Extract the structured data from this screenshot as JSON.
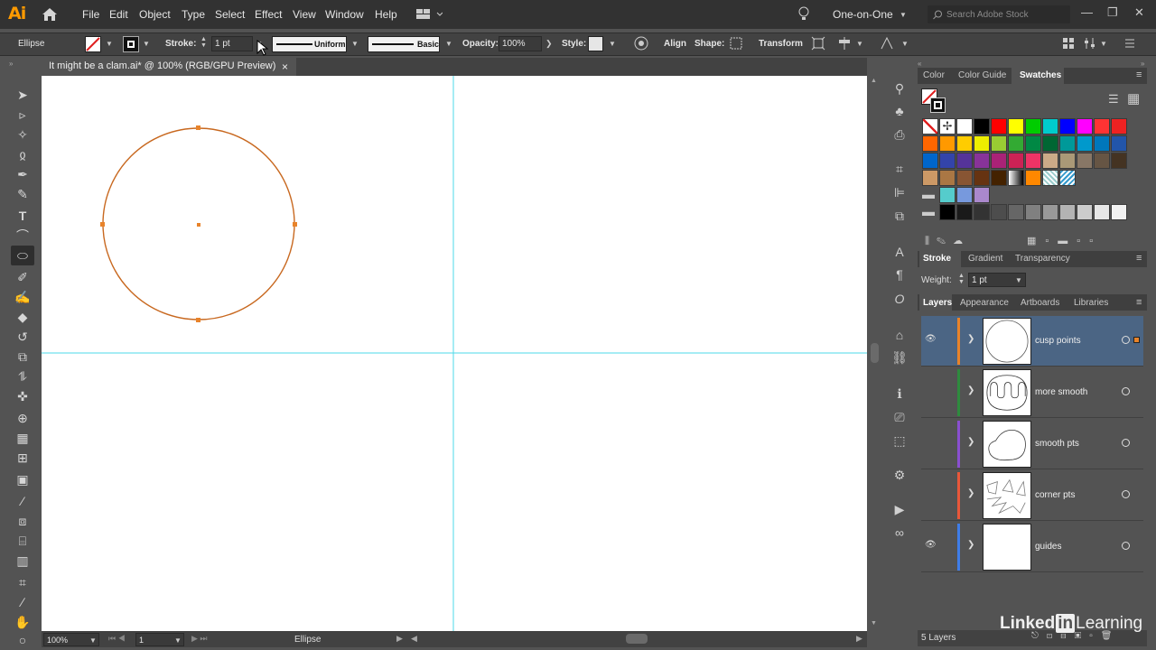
{
  "app": {
    "logo": "Ai"
  },
  "menu": [
    "File",
    "Edit",
    "Object",
    "Type",
    "Select",
    "Effect",
    "View",
    "Window",
    "Help"
  ],
  "workspace": {
    "label": "One-on-One",
    "search_placeholder": "Search Adobe Stock"
  },
  "control": {
    "object_type": "Ellipse",
    "stroke_label": "Stroke:",
    "stroke_value": "1 pt",
    "profile": "Uniform",
    "brush": "Basic",
    "opacity_label": "Opacity:",
    "opacity_value": "100%",
    "style_label": "Style:",
    "align_label": "Align",
    "shape_label": "Shape:",
    "transform_label": "Transform"
  },
  "document": {
    "tab_title": "It might be a clam.ai* @ 100% (RGB/GPU Preview)",
    "close": "×"
  },
  "status": {
    "zoom": "100%",
    "artboard": "1",
    "tool": "Ellipse"
  },
  "color_panel": {
    "tabs": [
      "Color",
      "Color Guide",
      "Swatches"
    ],
    "active": "Swatches"
  },
  "stroke_panel": {
    "tabs": [
      "Stroke",
      "Gradient",
      "Transparency"
    ],
    "weight_label": "Weight:",
    "weight_value": "1 pt"
  },
  "layers_panel": {
    "tabs": [
      "Layers",
      "Appearance",
      "Artboards",
      "Libraries"
    ],
    "footer": "5 Layers",
    "layers": [
      {
        "name": "cusp points",
        "color": "#e8832a",
        "visible": true,
        "selected": true
      },
      {
        "name": "more smooth",
        "color": "#2e8b3e",
        "visible": false,
        "selected": false
      },
      {
        "name": "smooth pts",
        "color": "#8a4fd0",
        "visible": false,
        "selected": false
      },
      {
        "name": "corner pts",
        "color": "#e8573a",
        "visible": false,
        "selected": false
      },
      {
        "name": "guides",
        "color": "#3f7de8",
        "visible": true,
        "selected": false
      }
    ]
  },
  "watermark": {
    "text1": "Linked",
    "text2": "in",
    "text3": "Learning"
  },
  "colors": {
    "accent": "#e8832a",
    "guide": "#4dd9e8",
    "selection": "#4b6584"
  }
}
